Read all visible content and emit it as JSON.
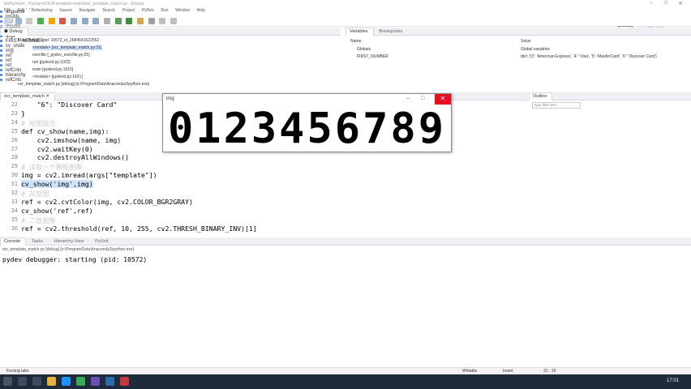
{
  "window": {
    "title": "wsPycharm - Pycharm/OCR-template-match/ocr_template_match.py - Eclipse"
  },
  "menu": [
    "File",
    "Edit",
    "Refactoring",
    "Source",
    "Navigate",
    "Search",
    "Project",
    "PyDev",
    "Run",
    "Window",
    "Help"
  ],
  "quick_access": "Quick",
  "debug": {
    "tab": "Debug",
    "rows": [
      "MainThread - pid: 10572_id_2684541522552",
      "<module> [ocr_template_match.py:31]",
      "execfile [_pydev_execfile.py:25]",
      "run [pydevd.py:1022]",
      "main [pydevd.py:1615]",
      "<module> [pydevd.py:1621]",
      "ocr_template_match.py [debug] [e:\\ProgramData\\Anaconda3\\python.exe]"
    ]
  },
  "variables": {
    "tabs": [
      "Variables",
      "Breakpoints"
    ],
    "col_name": "Name",
    "col_value": "Value",
    "rows": [
      {
        "name": "Globals",
        "value": "Global variables"
      },
      {
        "name": "FIRST_NUMBER",
        "value": "dict: {'3': 'American Express', '4': 'Visa', '5': 'MasterCard', '6': 'Discover Card'}"
      }
    ]
  },
  "editor": {
    "tab": "ocr_template_match",
    "lines": [
      {
        "n": "22",
        "code": "    \"6\": \"Discover Card\""
      },
      {
        "n": "23",
        "code": "}"
      },
      {
        "n": "24",
        "code": "# 绘图展示"
      },
      {
        "n": "25",
        "code": "def cv_show(name,img):"
      },
      {
        "n": "26",
        "code": "    cv2.imshow(name, img)"
      },
      {
        "n": "27",
        "code": "    cv2.waitKey(0)"
      },
      {
        "n": "28",
        "code": "    cv2.destroyAllWindows()"
      },
      {
        "n": "29",
        "code": "# 读取一个模板图像"
      },
      {
        "n": "30",
        "code": "img = cv2.imread(args[\"template\"])"
      },
      {
        "n": "31",
        "code": "cv_show('img',img)"
      },
      {
        "n": "32",
        "code": "# 灰度图"
      },
      {
        "n": "33",
        "code": "ref = cv2.cvtColor(img, cv2.COLOR_BGR2GRAY)"
      },
      {
        "n": "34",
        "code": "cv_show('ref',ref)"
      },
      {
        "n": "35",
        "code": "# 二值图像"
      },
      {
        "n": "36",
        "code": "ref = cv2.threshold(ref, 10, 255, cv2.THRESH_BINARY_INV)[1]"
      }
    ]
  },
  "outline": {
    "tab": "Outline",
    "filter": "type filter text",
    "items": [
      "contours (myutils)",
      "np = numpy",
      "argparse",
      "imutils",
      "cv2",
      "myutils",
      "ap",
      "args",
      "FIRST_NUMBER",
      "cv_show",
      "img",
      "ref",
      "ref",
      "ref",
      "refCnts",
      "hierarchy",
      "refCnts"
    ]
  },
  "console": {
    "tabs": [
      "Console",
      "Tasks",
      "Hierarchy View",
      "PyUnit"
    ],
    "process": "ocr_template_match.py [debug] [e:\\ProgramData\\Anaconda3\\python.exe]",
    "output": "pydev debugger: starting (pid: 10572)"
  },
  "image_window": {
    "title": "img",
    "digits": "0123456789"
  },
  "status": {
    "left": "Forcing tabs",
    "writable": "Writable",
    "insert": "Insert",
    "position": "31 : 19"
  },
  "taskbar": {
    "time": "17:01"
  }
}
